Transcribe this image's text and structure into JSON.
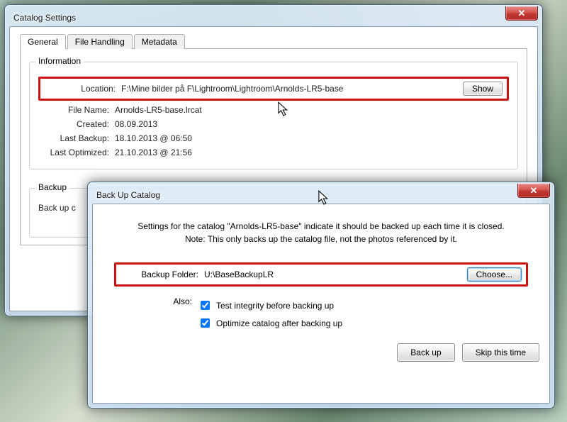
{
  "catalog": {
    "title": "Catalog Settings",
    "tabs": {
      "general": "General",
      "file_handling": "File Handling",
      "metadata": "Metadata"
    },
    "group_info": "Information",
    "labels": {
      "location": "Location:",
      "filename": "File Name:",
      "created": "Created:",
      "last_backup": "Last Backup:",
      "last_optimized": "Last Optimized:"
    },
    "values": {
      "location": "F:\\Mine bilder på F\\Lightroom\\Lightroom\\Arnolds-LR5-base",
      "filename": "Arnolds-LR5-base.lrcat",
      "created": "08.09.2013",
      "last_backup": "18.10.2013 @ 06:50",
      "last_optimized": "21.10.2013 @ 21:56"
    },
    "show": "Show",
    "group_backup": "Backup",
    "backup_each": "Back up c"
  },
  "backup": {
    "title": "Back Up Catalog",
    "note1": "Settings for the catalog \"Arnolds-LR5-base\" indicate it should be backed up each time it is closed.",
    "note2": "Note: This only backs up the catalog file, not the photos referenced by it.",
    "folder_label": "Backup Folder:",
    "folder": "U:\\BaseBackupLR",
    "choose": "Choose...",
    "also": "Also:",
    "test": "Test integrity before backing up",
    "optimize": "Optimize catalog after backing up",
    "backup_btn": "Back up",
    "skip": "Skip this time"
  }
}
